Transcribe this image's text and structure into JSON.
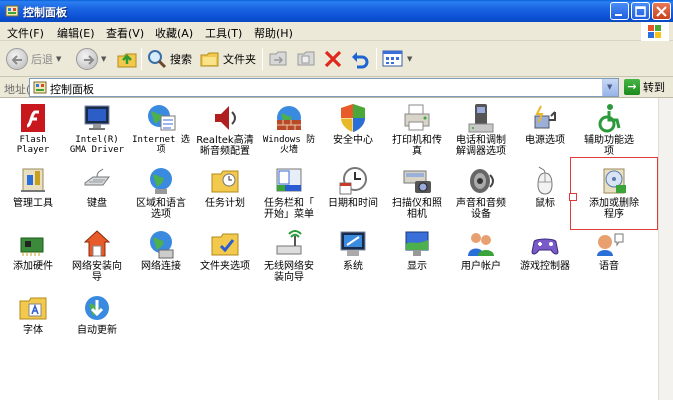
{
  "window": {
    "title": "控制面板"
  },
  "menubar": {
    "items": [
      "文件(F)",
      "编辑(E)",
      "查看(V)",
      "收藏(A)",
      "工具(T)",
      "帮助(H)"
    ]
  },
  "toolbar": {
    "back_label": "后退",
    "search_label": "搜索",
    "folders_label": "文件夹"
  },
  "address": {
    "label": "地址(D)",
    "value": "控制面板",
    "go_label": "转到"
  },
  "items": [
    {
      "label": "Flash\nPlayer",
      "icon": "flash-icon"
    },
    {
      "label": "Intel(R)\nGMA Driver",
      "icon": "monitor-icon"
    },
    {
      "label": "Internet 选\n项",
      "icon": "globe-icon"
    },
    {
      "label": "Realtek高清\n晰音频配置",
      "icon": "speaker-icon"
    },
    {
      "label": "Windows 防\n火墙",
      "icon": "firewall-icon"
    },
    {
      "label": "安全中心",
      "icon": "shield-icon"
    },
    {
      "label": "打印机和传\n真",
      "icon": "printer-icon"
    },
    {
      "label": "电话和调制\n解调器选项",
      "icon": "phone-icon"
    },
    {
      "label": "电源选项",
      "icon": "power-icon"
    },
    {
      "label": "辅助功能选\n项",
      "icon": "accessibility-icon"
    },
    {
      "label": "管理工具",
      "icon": "admin-tools-icon"
    },
    {
      "label": "键盘",
      "icon": "keyboard-icon"
    },
    {
      "label": "区域和语言\n选项",
      "icon": "region-icon"
    },
    {
      "label": "任务计划",
      "icon": "tasks-folder-icon"
    },
    {
      "label": "任务栏和「\n开始」菜单",
      "icon": "taskbar-icon"
    },
    {
      "label": "日期和时间",
      "icon": "clock-icon"
    },
    {
      "label": "扫描仪和照\n相机",
      "icon": "scanner-icon"
    },
    {
      "label": "声音和音频\n设备",
      "icon": "sound-icon"
    },
    {
      "label": "鼠标",
      "icon": "mouse-icon"
    },
    {
      "label": "添加或删除\n程序",
      "icon": "add-remove-icon"
    },
    {
      "label": "添加硬件",
      "icon": "hardware-icon"
    },
    {
      "label": "网络安装向\n导",
      "icon": "network-setup-icon"
    },
    {
      "label": "网络连接",
      "icon": "network-globe-icon"
    },
    {
      "label": "文件夹选项",
      "icon": "folder-options-icon"
    },
    {
      "label": "无线网络安\n装向导",
      "icon": "wireless-icon"
    },
    {
      "label": "系统",
      "icon": "system-icon"
    },
    {
      "label": "显示",
      "icon": "display-icon"
    },
    {
      "label": "用户帐户",
      "icon": "users-icon"
    },
    {
      "label": "游戏控制器",
      "icon": "gamepad-icon"
    },
    {
      "label": "语音",
      "icon": "speech-icon"
    },
    {
      "label": "字体",
      "icon": "fonts-folder-icon"
    },
    {
      "label": "自动更新",
      "icon": "update-icon"
    }
  ]
}
